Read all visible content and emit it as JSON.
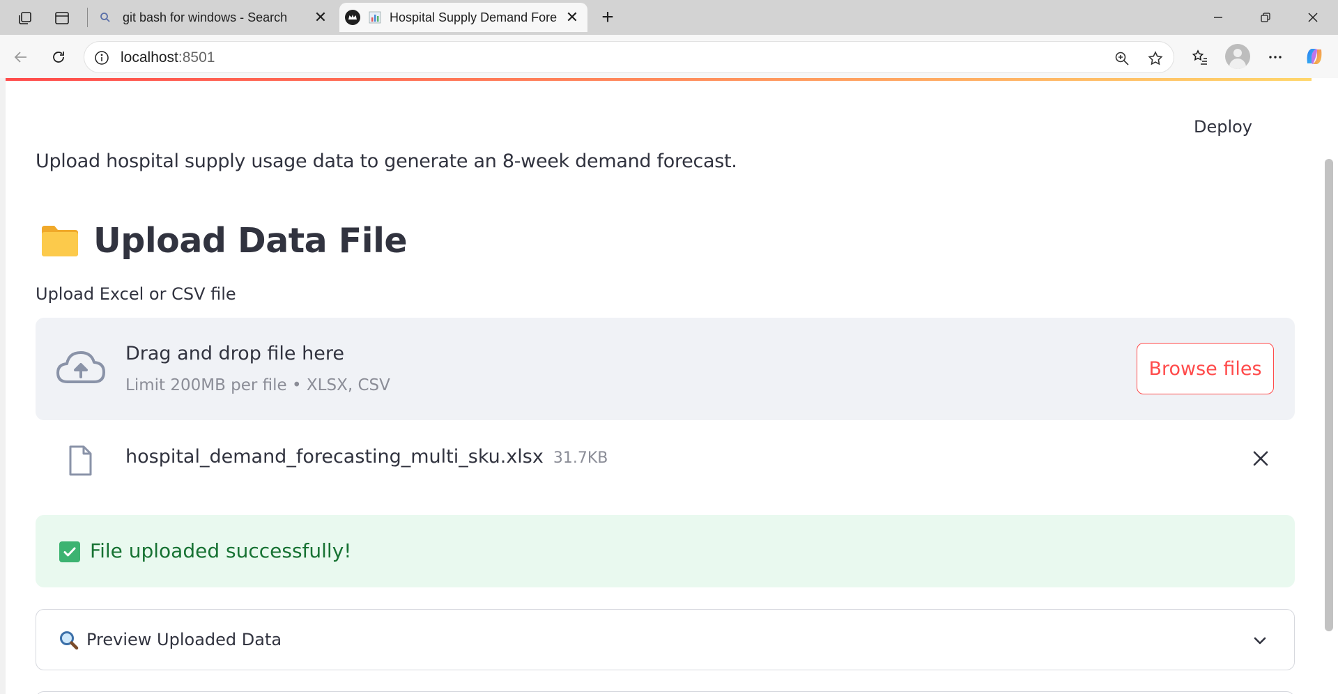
{
  "browser": {
    "tabs": [
      {
        "title": "git bash for windows - Search",
        "active": false,
        "icon": "search-icon"
      },
      {
        "title": "Hospital Supply Demand Fore",
        "active": true,
        "icon": "chart-icon"
      }
    ],
    "url_host": "localhost",
    "url_port": ":8501"
  },
  "app": {
    "deploy_label": "Deploy",
    "intro_text": "Upload hospital supply usage data to generate an 8-week demand forecast.",
    "section_title": "Upload Data File",
    "uploader": {
      "label": "Upload Excel or CSV file",
      "drop_title": "Drag and drop file here",
      "drop_subtitle": "Limit 200MB per file • XLSX, CSV",
      "browse_label": "Browse files"
    },
    "uploaded_file": {
      "name": "hospital_demand_forecasting_multi_sku.xlsx",
      "size": "31.7KB"
    },
    "success_message": "File uploaded successfully!",
    "expander_label": "Preview Uploaded Data"
  },
  "colors": {
    "accent": "#ff4b4b",
    "success_bg": "#e9f9ef",
    "success_text": "#177233",
    "dropzone_bg": "#f0f2f6",
    "text": "#31333f"
  }
}
